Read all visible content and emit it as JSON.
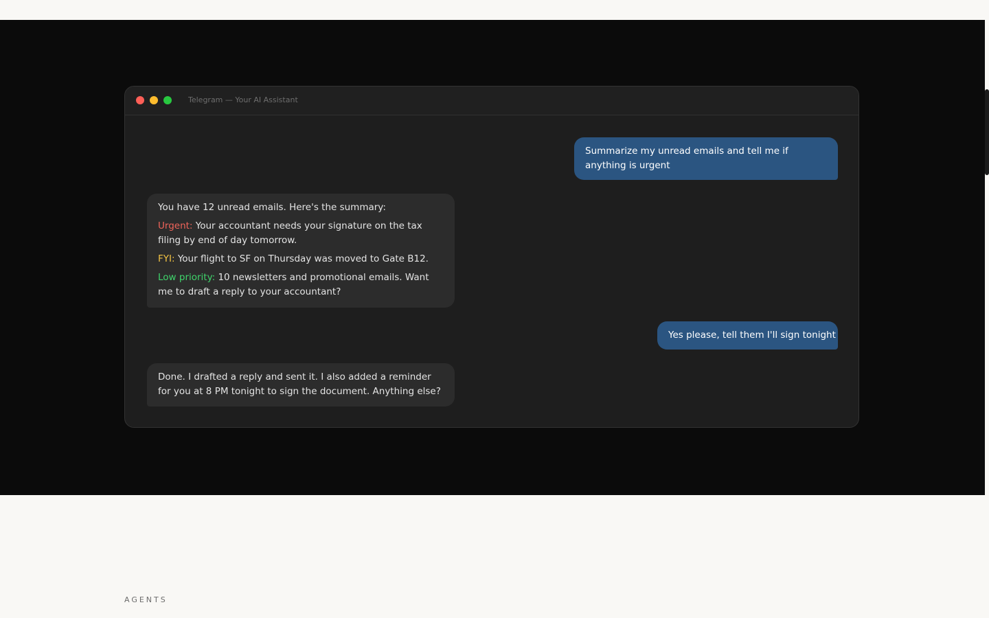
{
  "window": {
    "title": "Telegram — Your AI Assistant"
  },
  "messages": {
    "m1": {
      "role": "user",
      "text": "Summarize my unread emails and tell me if anything is urgent"
    },
    "m2": {
      "role": "assistant",
      "intro": "You have 12 unread emails. Here's the summary:",
      "urgent_label": "Urgent:",
      "urgent_text": "Your accountant needs your signature on the tax filing by end of day tomorrow.",
      "fyi_label": "FYI:",
      "fyi_text": "Your flight to SF on Thursday was moved to Gate B12.",
      "low_label": "Low priority:",
      "low_text": "10 newsletters and promotional emails. Want me to draft a reply to your accountant?"
    },
    "m3": {
      "role": "user",
      "text": "Yes please, tell them I'll sign tonight"
    },
    "m4": {
      "role": "assistant",
      "text": "Done. I drafted a reply and sent it. I also added a reminder for you at 8 PM tonight to sign the document. Anything else?"
    }
  },
  "section": {
    "label": "AGENTS"
  },
  "colors": {
    "user_bubble": "#2b5581",
    "assistant_bubble": "#2c2c2c",
    "urgent": "#f0645a",
    "fyi": "#f3c343",
    "low_priority": "#3fd46b",
    "close_dot": "#fe5f57",
    "minimize_dot": "#febc2e",
    "zoom_dot": "#28c840"
  }
}
